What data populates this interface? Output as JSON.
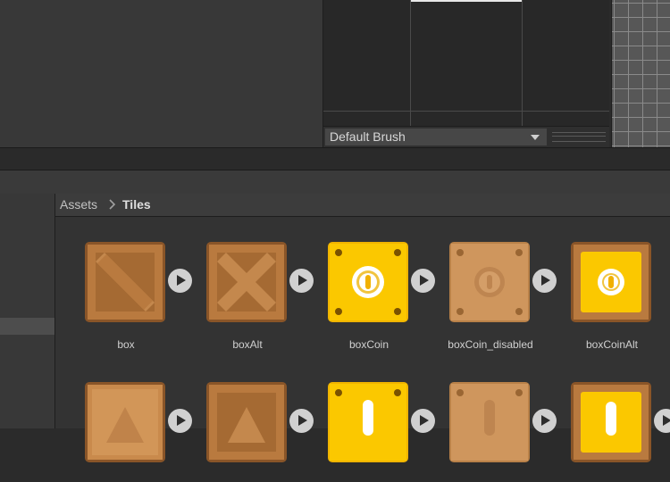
{
  "tile_palette": {
    "brush_dropdown": "Default Brush"
  },
  "breadcrumb": {
    "root": "Assets",
    "current": "Tiles"
  },
  "assets_row1": [
    {
      "label": "box"
    },
    {
      "label": "boxAlt"
    },
    {
      "label": "boxCoin"
    },
    {
      "label": "boxCoin_disabled"
    },
    {
      "label": "boxCoinAlt"
    }
  ],
  "colors": {
    "box_brown": "#b97a3f",
    "box_brown_dark": "#8a5528",
    "coin_yellow": "#fbc800",
    "disabled_tan": "#cf965d",
    "editor_bg": "#333333"
  }
}
